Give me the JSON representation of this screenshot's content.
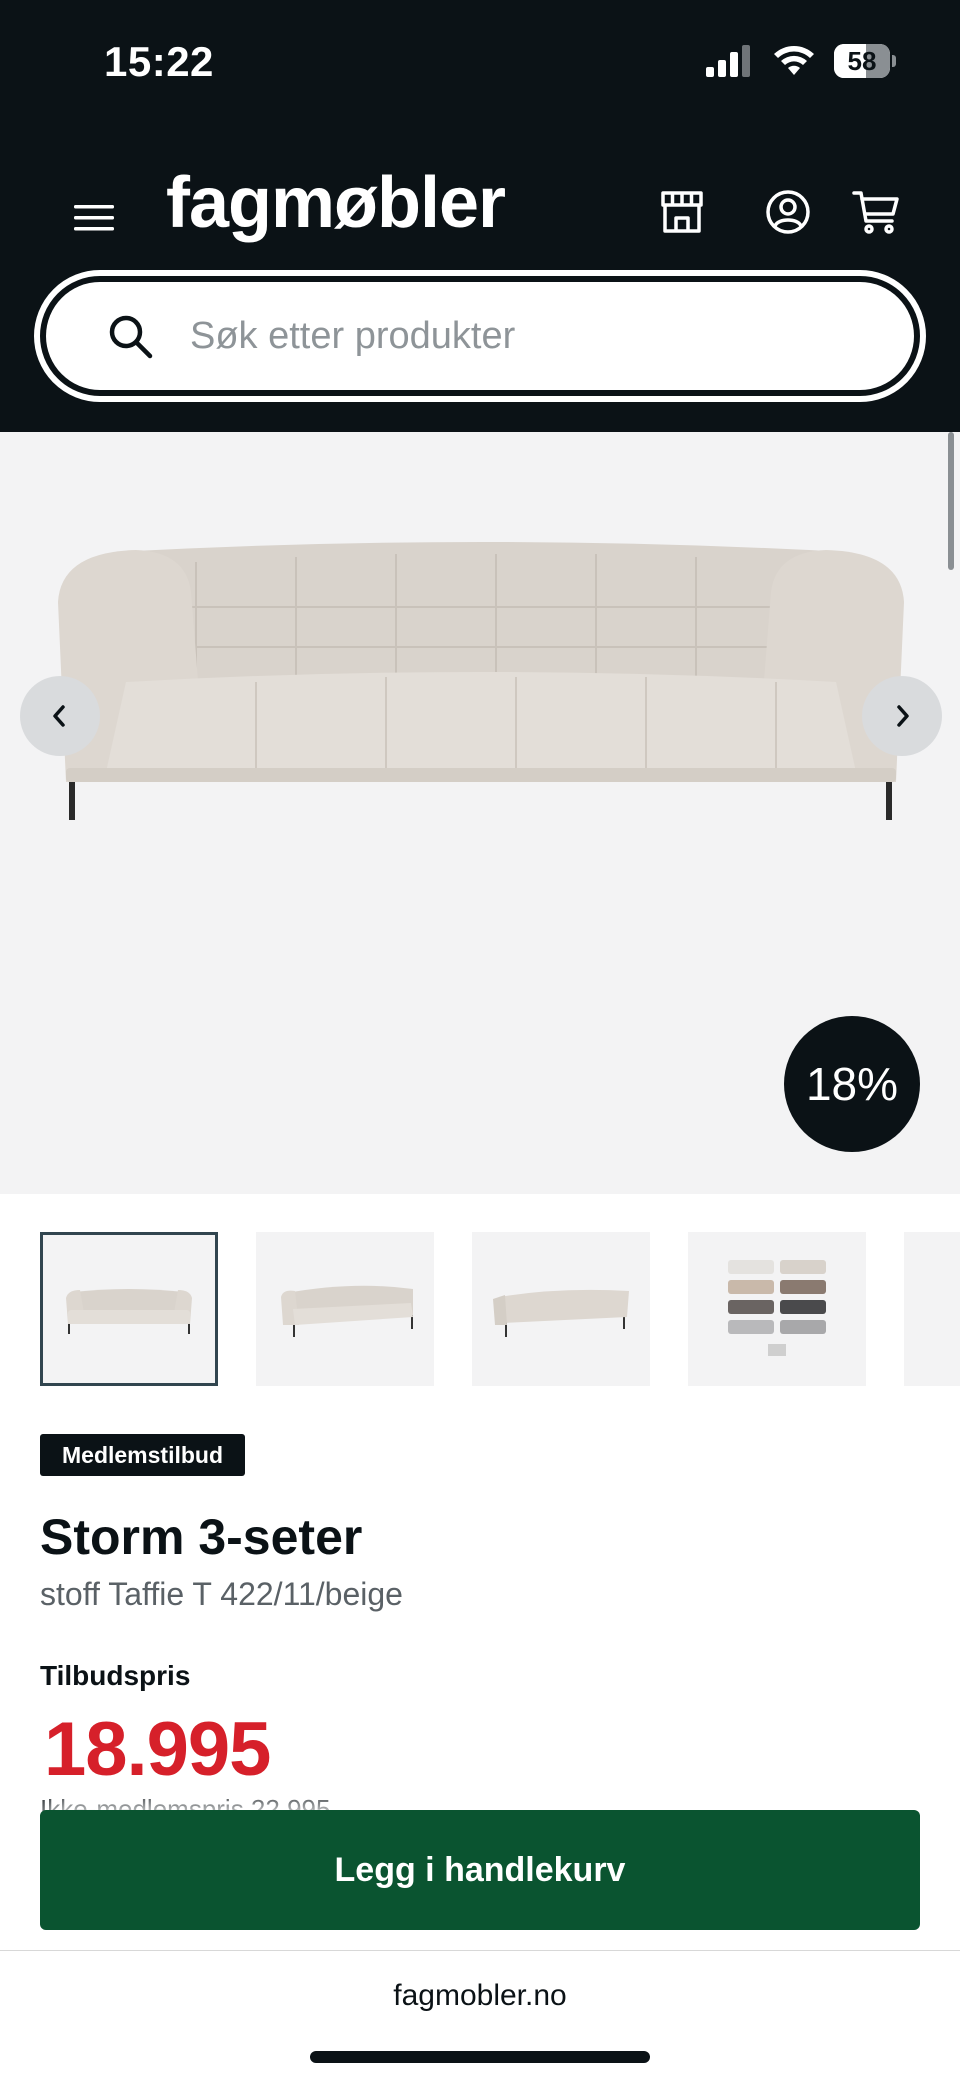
{
  "status_bar": {
    "time": "15:22",
    "battery": "58",
    "battery_level": 0.58,
    "icons": [
      "cellular-signal-icon",
      "wifi-icon",
      "battery-icon"
    ]
  },
  "header": {
    "logo": "fagmøbler",
    "icons": [
      "hamburger-menu-icon",
      "store-icon",
      "user-account-icon",
      "shopping-cart-icon"
    ],
    "search": {
      "placeholder": "Søk etter produkter",
      "value": ""
    }
  },
  "gallery": {
    "discount_badge": "18%",
    "image": "sofa-photo",
    "thumbnails": [
      "sofa-front-thumbnail",
      "sofa-angle-thumbnail",
      "sofa-back-thumbnail",
      "fabric-swatches-thumbnail",
      "more-thumbnail"
    ],
    "active_thumbnail": 0
  },
  "product": {
    "badge": "Medlemstilbud",
    "title": "Storm 3-seter",
    "subtitle": "stoff Taffie T 422/11/beige",
    "price_label": "Tilbudspris",
    "price": "18.995",
    "member_price_note": "Ikke-medlemspris 22.995"
  },
  "cta": {
    "label": "Legg i handlekurv"
  },
  "browser": {
    "url": "fagmobler.no"
  },
  "colors": {
    "header_bg": "#0b1216",
    "price_red": "#d6202a",
    "cta_green": "#0a5430",
    "hero_bg": "#f3f3f4"
  }
}
